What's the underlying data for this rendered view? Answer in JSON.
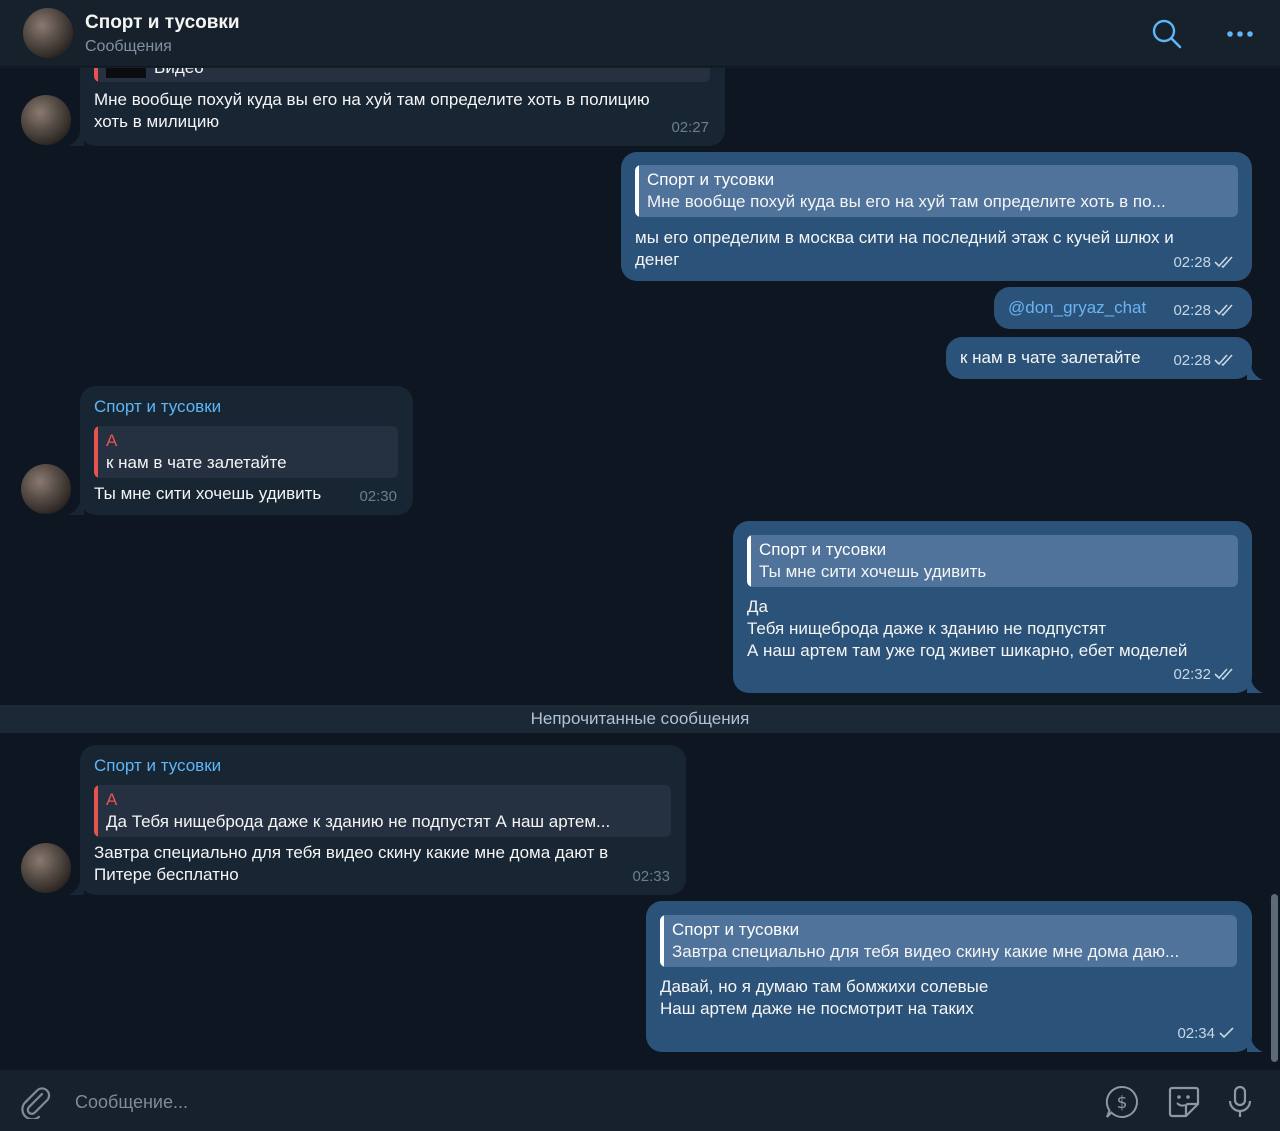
{
  "header": {
    "title": "Спорт и тусовки",
    "subtitle": "Сообщения"
  },
  "messages": [
    {
      "direction": "in",
      "reply_media_label": "Видео",
      "text": "Мне вообще похуй куда вы его на хуй там определите хоть в полицию\nхоть в милицию",
      "time": "02:27"
    },
    {
      "direction": "out",
      "reply": {
        "author": "Спорт и тусовки",
        "text": "Мне вообще похуй куда вы его на хуй там определите хоть в по..."
      },
      "text": "мы его определим в москва сити на последний этаж с кучей шлюх и\nденег",
      "time": "02:28",
      "status": "read"
    },
    {
      "direction": "out",
      "text": "@don_gryaz_chat",
      "time": "02:28",
      "status": "read"
    },
    {
      "direction": "out",
      "text": "к нам в чате залетайте",
      "time": "02:28",
      "status": "read"
    },
    {
      "direction": "in",
      "sender": "Спорт и тусовки",
      "reply": {
        "author": "А",
        "text": "к нам в чате залетайте"
      },
      "text": "Ты мне сити хочешь удивить",
      "time": "02:30"
    },
    {
      "direction": "out",
      "reply": {
        "author": "Спорт и тусовки",
        "text": "Ты мне сити хочешь удивить"
      },
      "text": "Да\nТебя нищеброда даже к зданию не подпустят\nА наш артем там уже год живет шикарно, ебет моделей",
      "time": "02:32",
      "status": "read"
    },
    {
      "direction": "in",
      "sender": "Спорт и тусовки",
      "reply": {
        "author": "А",
        "text": "Да Тебя нищеброда даже к зданию не подпустят А наш артем..."
      },
      "text": "Завтра специально для тебя видео скину какие мне дома дают в\nПитере бесплатно",
      "time": "02:33"
    },
    {
      "direction": "out",
      "reply": {
        "author": "Спорт и тусовки",
        "text": "Завтра специально для тебя видео скину какие мне дома даю..."
      },
      "text": "Давай, но я думаю там бомжихи солевые\nНаш артем даже не посмотрит на таких",
      "time": "02:34",
      "status": "sent"
    }
  ],
  "unread_divider": "Непрочитанные сообщения",
  "composer": {
    "placeholder": "Сообщение...",
    "icons": [
      "attach-icon",
      "dollar-icon",
      "sticker-icon",
      "microphone-icon"
    ]
  },
  "colors": {
    "background": "#0e1621",
    "header": "#17212b",
    "incoming_bubble": "#182533",
    "outgoing_bubble": "#2b5278",
    "accent": "#5eb5f7",
    "reply_author_in": "#e5544f"
  }
}
